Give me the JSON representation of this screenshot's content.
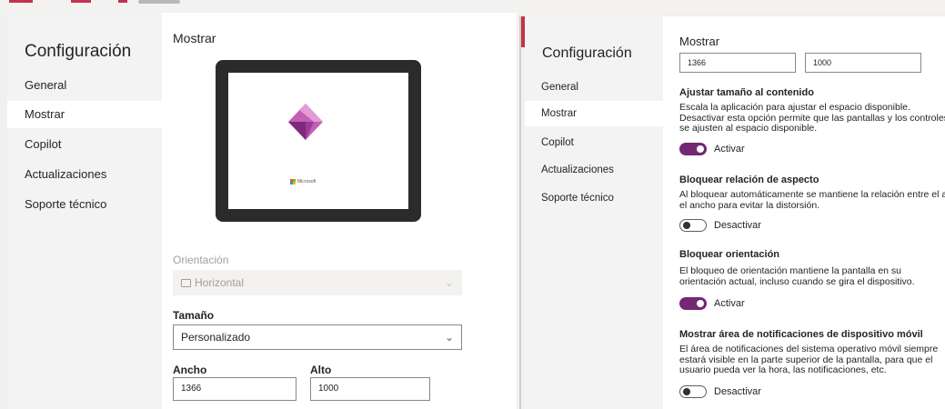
{
  "left": {
    "nav": {
      "title": "Configuración",
      "items": [
        {
          "label": "General"
        },
        {
          "label": "Mostrar"
        },
        {
          "label": "Copilot"
        },
        {
          "label": "Actualizaciones"
        },
        {
          "label": "Soporte técnico"
        }
      ],
      "active": "Mostrar"
    },
    "section_title": "Mostrar",
    "preview": {
      "brand": "Microsoft"
    },
    "orientation": {
      "label": "Orientación",
      "value": "Horizontal",
      "icon": "tablet-icon",
      "disabled": true
    },
    "size": {
      "label": "Tamaño",
      "value": "Personalizado"
    },
    "width": {
      "label": "Ancho",
      "value": "1366"
    },
    "height": {
      "label": "Alto",
      "value": "1000"
    }
  },
  "right": {
    "nav": {
      "title": "Configuración",
      "items": [
        {
          "label": "General"
        },
        {
          "label": "Mostrar"
        },
        {
          "label": "Copilot"
        },
        {
          "label": "Actualizaciones"
        },
        {
          "label": "Soporte técnico"
        }
      ],
      "active": "Mostrar"
    },
    "section_title": "Mostrar",
    "width_value": "1366",
    "height_value": "1000",
    "settings": [
      {
        "title": "Ajustar tamaño al contenido",
        "description": "Escala la aplicación para ajustar el espacio disponible. Desactivar esta opción permite que las pantallas y los controles se ajusten al espacio disponible.",
        "state": "on",
        "state_label": "Activar"
      },
      {
        "title": "Bloquear relación de aspecto",
        "description": "Al bloquear automáticamente se mantiene la relación entre el alto y el ancho para evitar la distorsión.",
        "state": "off",
        "state_label": "Desactivar"
      },
      {
        "title": "Bloquear orientación",
        "description": "El bloqueo de orientación mantiene la pantalla en su orientación actual, incluso cuando se gira el dispositivo.",
        "state": "on",
        "state_label": "Activar"
      },
      {
        "title": "Mostrar área de notificaciones de dispositivo móvil",
        "description": "El área de notificaciones del sistema operativo móvil siempre estará visible en la parte superior de la pantalla, para que el usuario pueda ver la hora, las notificaciones, etc.",
        "state": "off",
        "state_label": "Desactivar"
      }
    ]
  },
  "colors": {
    "toggle_on": "#742774",
    "accent_red": "#c4314b",
    "nav_bg": "#f3f3f3"
  }
}
